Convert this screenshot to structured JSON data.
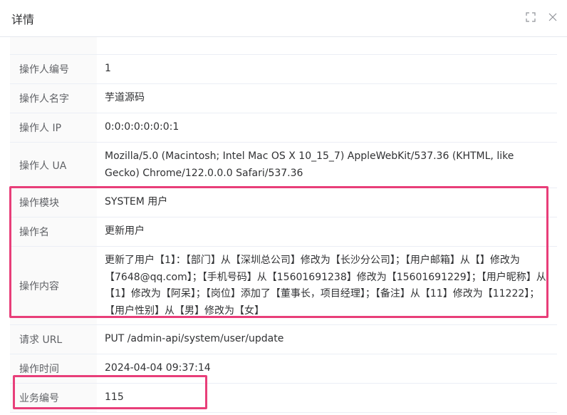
{
  "dialog": {
    "title": "详情",
    "maximize_icon": "maximize-icon",
    "close_icon": "close-icon"
  },
  "details": {
    "rows": [
      {
        "label": "操作人编号",
        "value": "1"
      },
      {
        "label": "操作人名字",
        "value": "芋道源码"
      },
      {
        "label": "操作人 IP",
        "value": "0:0:0:0:0:0:0:1"
      },
      {
        "label": "操作人 UA",
        "value": "Mozilla/5.0 (Macintosh; Intel Mac OS X 10_15_7) AppleWebKit/537.36 (KHTML, like Gecko) Chrome/122.0.0.0 Safari/537.36"
      },
      {
        "label": "操作模块",
        "value": "SYSTEM 用户"
      },
      {
        "label": "操作名",
        "value": "更新用户"
      },
      {
        "label": "操作内容",
        "value": "更新了用户【1】：【部门】从【深圳总公司】修改为【长沙分公司】；【用户邮箱】从【】修改为【7648@qq.com】；【手机号码】从【15601691238】修改为【15601691229】；【用户昵称】从【1】修改为【阿呆】；【岗位】添加了【董事长，项目经理】；【备注】从【11】修改为【11222】；【用户性别】从【男】修改为【女】"
      },
      {
        "label": "请求 URL",
        "value": "PUT /admin-api/system/user/update"
      },
      {
        "label": "操作时间",
        "value": "2024-04-04 09:37:14"
      },
      {
        "label": "业务编号",
        "value": "115"
      }
    ]
  },
  "colors": {
    "highlight": "#e83e79",
    "label_bg": "#fafafa",
    "border": "#ebeef5"
  }
}
